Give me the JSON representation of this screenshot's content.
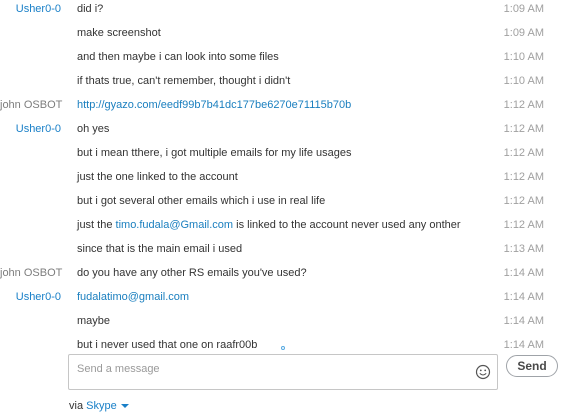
{
  "messages": [
    {
      "sender": "Usher0-0",
      "sender_type": "usher",
      "text": "did i?",
      "time": "1:09 AM"
    },
    {
      "sender": "",
      "sender_type": "usher",
      "text": "make screenshot",
      "time": "1:09 AM"
    },
    {
      "sender": "",
      "sender_type": "usher",
      "text": "and then maybe i can look into some files",
      "time": "1:10 AM"
    },
    {
      "sender": "",
      "sender_type": "usher",
      "text": "if thats true, can't remember, thought i didn't",
      "time": "1:10 AM"
    },
    {
      "sender": "john OSBOT",
      "sender_type": "john",
      "link": "http://gyazo.com/eedf99b7b41dc177be6270e71115b70b",
      "time": "1:12 AM"
    },
    {
      "sender": "Usher0-0",
      "sender_type": "usher",
      "text": "oh yes",
      "time": "1:12 AM"
    },
    {
      "sender": "",
      "sender_type": "usher",
      "text": "but i mean tthere, i got multiple emails for my life usages",
      "time": "1:12 AM"
    },
    {
      "sender": "",
      "sender_type": "usher",
      "text": "just the one linked to the account",
      "time": "1:12 AM"
    },
    {
      "sender": "",
      "sender_type": "usher",
      "text": "but i got several other emails which i use in real life",
      "time": "1:12 AM"
    },
    {
      "sender": "",
      "sender_type": "usher",
      "text_before": "just the ",
      "link": "timo.fudala@Gmail.com",
      "text_after": " is linked to the account never used any onther",
      "time": "1:12 AM"
    },
    {
      "sender": "",
      "sender_type": "usher",
      "text": "since that is the main email i used",
      "time": "1:13 AM"
    },
    {
      "sender": "john OSBOT",
      "sender_type": "john",
      "text": "do you have any other RS emails you've used?",
      "time": "1:14 AM"
    },
    {
      "sender": "Usher0-0",
      "sender_type": "usher",
      "link": "fudalatimo@gmail.com",
      "time": "1:14 AM"
    },
    {
      "sender": "",
      "sender_type": "usher",
      "text": "maybe",
      "time": "1:14 AM"
    },
    {
      "sender": "",
      "sender_type": "usher",
      "text": "but i never used that one on raafr00b",
      "time": "1:14 AM"
    }
  ],
  "composer": {
    "placeholder": "Send a message",
    "emoji_icon": "smiley-icon",
    "send_label": "Send"
  },
  "footer": {
    "via_label": "via",
    "service_label": "Skype",
    "dropdown_icon": "caret-down-icon"
  },
  "colors": {
    "accent": "#1a80c8",
    "link": "#1a7fbf",
    "time": "#a0a0a0"
  }
}
